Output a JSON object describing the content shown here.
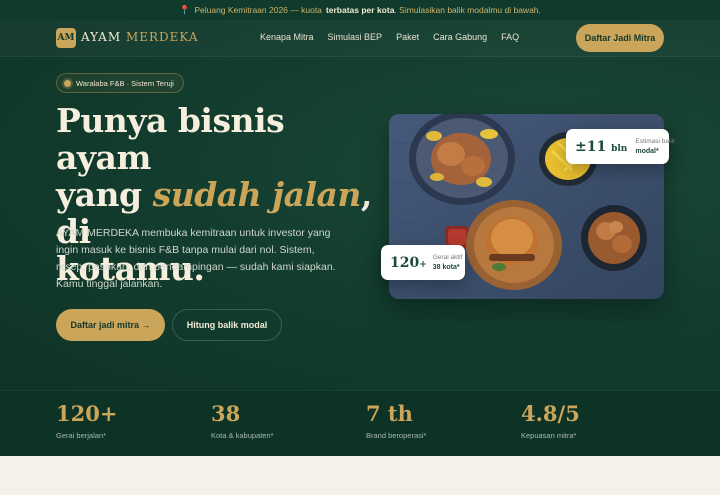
{
  "announcement": {
    "icon": "pin-icon",
    "prefix": "Peluang Kemitraan 2026 — kuota",
    "highlight": "terbatas per kota",
    "suffix": ". Simulasikan balik modalmu di bawah."
  },
  "nav": {
    "logo_mark": "AM",
    "brand_first": "AYAM",
    "brand_second": "MERDEKA",
    "links": [
      "Kenapa Mitra",
      "Simulasi BEP",
      "Paket",
      "Cara Gabung",
      "FAQ"
    ],
    "cta": "Daftar Jadi Mitra"
  },
  "hero": {
    "badge": "Waralaba F&B · Sistem Teruji",
    "headline_line1": "Punya bisnis ayam",
    "headline_pre": "yang",
    "headline_accent": "sudah jalan",
    "headline_post": ", di",
    "headline_line3": "kotamu.",
    "lede": "AYAM MERDEKA membuka kemitraan untuk investor yang ingin masuk ke bisnis F&B tanpa mulai dari nol. Sistem, resep, pasokan, dan pendampingan — sudah kami siapkan. Kamu tinggal jalankan.",
    "primary_button": "Daftar jadi mitra →",
    "secondary_button": "Hitung balik modal"
  },
  "cards": {
    "payback_value": "±11",
    "payback_unit": "bln",
    "payback_label": "Estimasi balik",
    "payback_sub": "modal*",
    "outlets_value": "120",
    "outlets_unit": "+",
    "outlets_label": "Gerai aktif",
    "outlets_sub": "38 kota*"
  },
  "stats": [
    {
      "value": "120+",
      "label": "Gerai berjalan*"
    },
    {
      "value": "38",
      "label": "Kota & kabupaten*"
    },
    {
      "value": "7 th",
      "label": "Brand beroperasi*"
    },
    {
      "value": "4.8/5",
      "label": "Kepuasan mitra*"
    }
  ],
  "colors": {
    "brand_green": "#133d2f",
    "gold": "#caa55a",
    "cream": "#f5f0e8"
  }
}
